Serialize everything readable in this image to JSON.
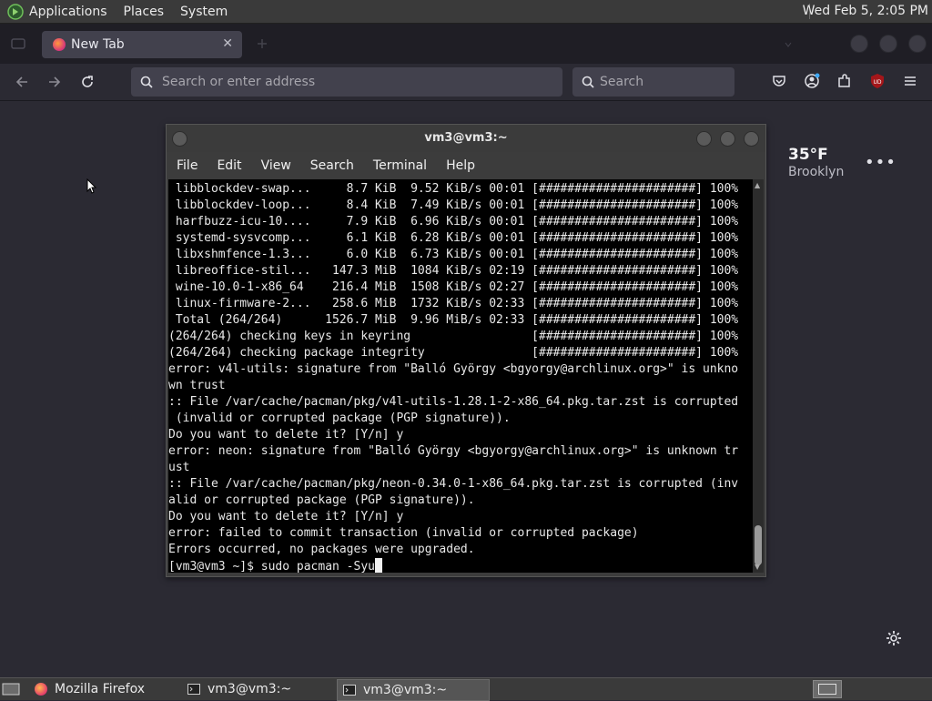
{
  "top_panel": {
    "menus": [
      "Applications",
      "Places",
      "System"
    ],
    "clock": "Wed Feb  5, 2:05 PM"
  },
  "browser": {
    "tab": {
      "title": "New Tab"
    },
    "urlbar": {
      "placeholder": "Search or enter address"
    },
    "searchbar": {
      "placeholder": "Search"
    }
  },
  "newtab": {
    "weather": {
      "temperature": "35°F",
      "location": "Brooklyn"
    },
    "weather_menu": "•••"
  },
  "terminal": {
    "title": "vm3@vm3:~",
    "menus": [
      "File",
      "Edit",
      "View",
      "Search",
      "Terminal",
      "Help"
    ],
    "lines": [
      " libblockdev-swap...     8.7 KiB  9.52 KiB/s 00:01 [######################] 100%",
      " libblockdev-loop...     8.4 KiB  7.49 KiB/s 00:01 [######################] 100%",
      " harfbuzz-icu-10....     7.9 KiB  6.96 KiB/s 00:01 [######################] 100%",
      " systemd-sysvcomp...     6.1 KiB  6.28 KiB/s 00:01 [######################] 100%",
      " libxshmfence-1.3...     6.0 KiB  6.73 KiB/s 00:01 [######################] 100%",
      " libreoffice-stil...   147.3 MiB  1084 KiB/s 02:19 [######################] 100%",
      " wine-10.0-1-x86_64    216.4 MiB  1508 KiB/s 02:27 [######################] 100%",
      " linux-firmware-2...   258.6 MiB  1732 KiB/s 02:33 [######################] 100%",
      " Total (264/264)      1526.7 MiB  9.96 MiB/s 02:33 [######################] 100%",
      "(264/264) checking keys in keyring                 [######################] 100%",
      "(264/264) checking package integrity               [######################] 100%",
      "error: v4l-utils: signature from \"Balló György <bgyorgy@archlinux.org>\" is unkno",
      "wn trust",
      ":: File /var/cache/pacman/pkg/v4l-utils-1.28.1-2-x86_64.pkg.tar.zst is corrupted",
      " (invalid or corrupted package (PGP signature)).",
      "Do you want to delete it? [Y/n] y",
      "error: neon: signature from \"Balló György <bgyorgy@archlinux.org>\" is unknown tr",
      "ust",
      ":: File /var/cache/pacman/pkg/neon-0.34.0-1-x86_64.pkg.tar.zst is corrupted (inv",
      "alid or corrupted package (PGP signature)).",
      "Do you want to delete it? [Y/n] y",
      "error: failed to commit transaction (invalid or corrupted package)",
      "Errors occurred, no packages were upgraded."
    ],
    "prompt": "[vm3@vm3 ~]$ ",
    "input": "sudo pacman -Syu"
  },
  "taskbar": {
    "tasks": [
      {
        "label": "Mozilla Firefox"
      },
      {
        "label": "vm3@vm3:~"
      },
      {
        "label": "vm3@vm3:~"
      }
    ]
  }
}
